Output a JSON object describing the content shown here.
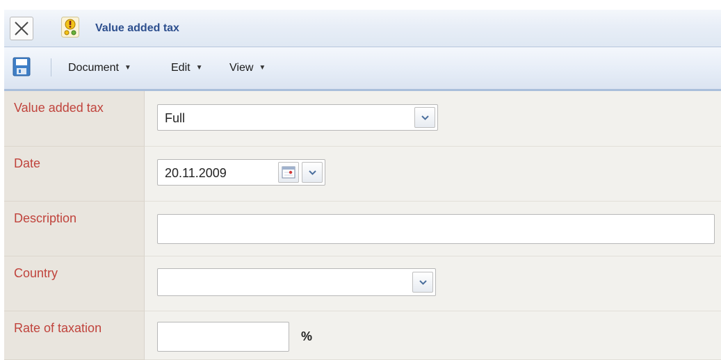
{
  "window": {
    "title": "Value added tax",
    "close_icon": "close-icon",
    "app_icon": "tax-app-icon"
  },
  "toolbar": {
    "save_icon": "save-icon",
    "menus": [
      {
        "label": "Document"
      },
      {
        "label": "Edit"
      },
      {
        "label": "View"
      }
    ]
  },
  "form": {
    "vat": {
      "label": "Value added tax",
      "value": "Full"
    },
    "date": {
      "label": "Date",
      "value": "20.11.2009"
    },
    "description": {
      "label": "Description",
      "value": ""
    },
    "country": {
      "label": "Country",
      "value": ""
    },
    "rate": {
      "label": "Rate of taxation",
      "value": "",
      "unit": "%"
    }
  },
  "colors": {
    "label_text": "#c0433c",
    "title_text": "#2d4f8e",
    "label_bg": "#e9e5de",
    "field_bg": "#f2f1ed"
  }
}
